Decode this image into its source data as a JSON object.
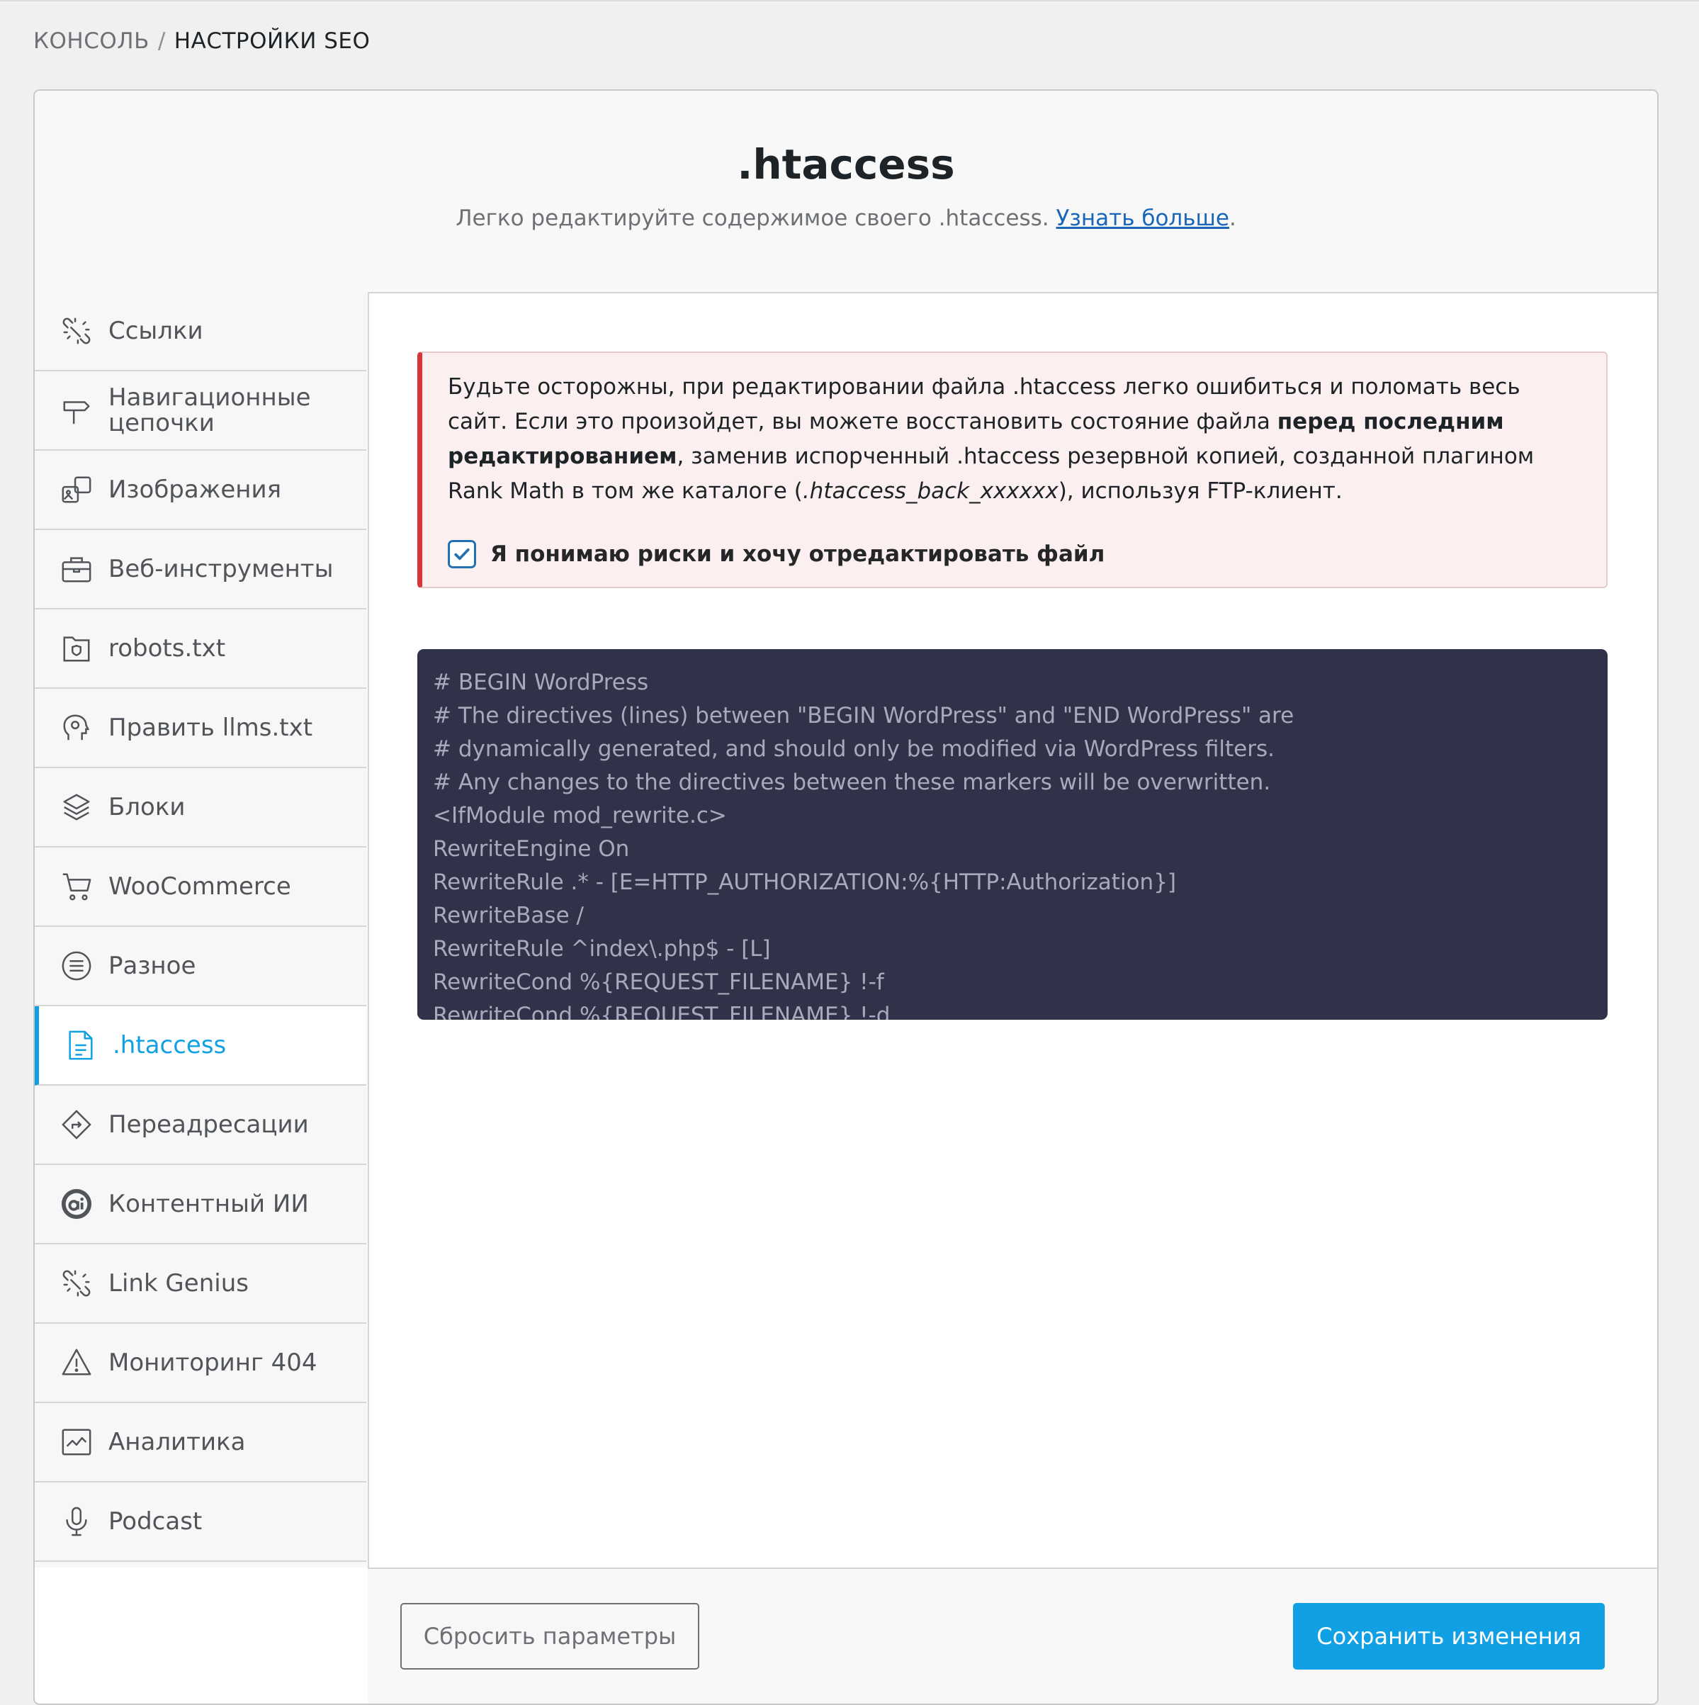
{
  "breadcrumb": {
    "root": "КОНСОЛЬ",
    "separator": "/",
    "current": "НАСТРОЙКИ SEO"
  },
  "header": {
    "title": ".htaccess",
    "subtitle": "Легко редактируйте содержимое своего .htaccess.",
    "learn_more": "Узнать больше",
    "period": "."
  },
  "sidebar": {
    "items": [
      {
        "label": "Ссылки",
        "icon": "link-icon"
      },
      {
        "label": "Навигационные цепочки",
        "icon": "signpost-icon"
      },
      {
        "label": "Изображения",
        "icon": "images-icon"
      },
      {
        "label": "Веб-инструменты",
        "icon": "toolbox-icon"
      },
      {
        "label": "robots.txt",
        "icon": "folder-shield-icon"
      },
      {
        "label": "Править llms.txt",
        "icon": "ai-head-icon"
      },
      {
        "label": "Блоки",
        "icon": "blocks-icon"
      },
      {
        "label": "WooCommerce",
        "icon": "cart-icon"
      },
      {
        "label": "Разное",
        "icon": "misc-list-icon"
      },
      {
        "label": ".htaccess",
        "icon": "document-icon",
        "active": true
      },
      {
        "label": "Переадресации",
        "icon": "redirect-icon"
      },
      {
        "label": "Контентный ИИ",
        "icon": "content-ai-icon"
      },
      {
        "label": "Link Genius",
        "icon": "link-icon"
      },
      {
        "label": "Мониторинг 404",
        "icon": "warning-icon"
      },
      {
        "label": "Аналитика",
        "icon": "analytics-icon"
      },
      {
        "label": "Podcast",
        "icon": "microphone-icon"
      }
    ]
  },
  "alert": {
    "text_1": "Будьте осторожны, при редактировании файла .htaccess легко ошибиться и поломать весь сайт. Если это произойдет, вы можете восстановить состояние файла ",
    "text_bold": "перед последним редактированием",
    "text_2": ", заменив испорченный .htaccess резервной копией, созданной плагином Rank Math в том же каталоге (",
    "text_italic": ".htaccess_back_xxxxxx",
    "text_3": "), используя FTP-клиент.",
    "checkbox_label": "Я понимаю риски и хочу отредактировать файл",
    "checked": true
  },
  "code": {
    "lines": [
      "# BEGIN WordPress",
      "# The directives (lines) between \"BEGIN WordPress\" and \"END WordPress\" are",
      "# dynamically generated, and should only be modified via WordPress filters.",
      "# Any changes to the directives between these markers will be overwritten.",
      "<IfModule mod_rewrite.c>",
      "RewriteEngine On",
      "RewriteRule .* - [E=HTTP_AUTHORIZATION:%{HTTP:Authorization}]",
      "RewriteBase /",
      "RewriteRule ^index\\.php$ - [L]",
      "RewriteCond %{REQUEST_FILENAME} !-f",
      "RewriteCond %{REQUEST_FILENAME} !-d"
    ]
  },
  "footer": {
    "reset_label": "Сбросить параметры",
    "save_label": "Сохранить изменения"
  },
  "colors": {
    "accent": "#11a0e4",
    "danger": "#d63638",
    "code_bg": "#30324a",
    "link": "#1a66b8"
  }
}
